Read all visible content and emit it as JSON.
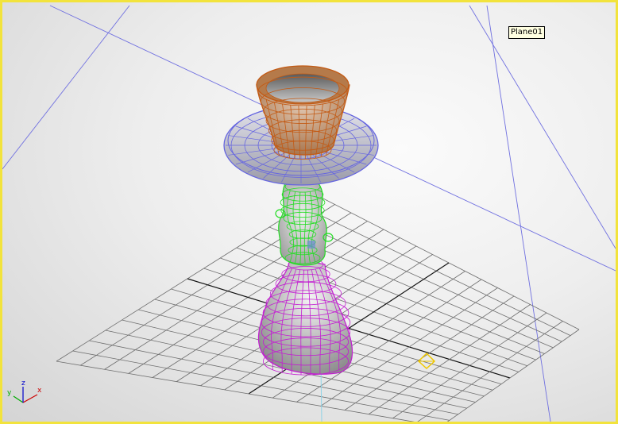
{
  "viewport": {
    "object_label": "Plane01",
    "axis_labels": {
      "x": "x",
      "y": "y",
      "z": "z"
    }
  },
  "colors": {
    "viewport_border": "#f2e33c",
    "grid": "#6e6e6e",
    "bowl_wire": "#c35a14",
    "saucer_wire": "#6666e0",
    "stem_wire": "#22dd22",
    "base_wire": "#c31ed2",
    "guide_line": "#7070e0",
    "gizmo": "#f0c800"
  }
}
